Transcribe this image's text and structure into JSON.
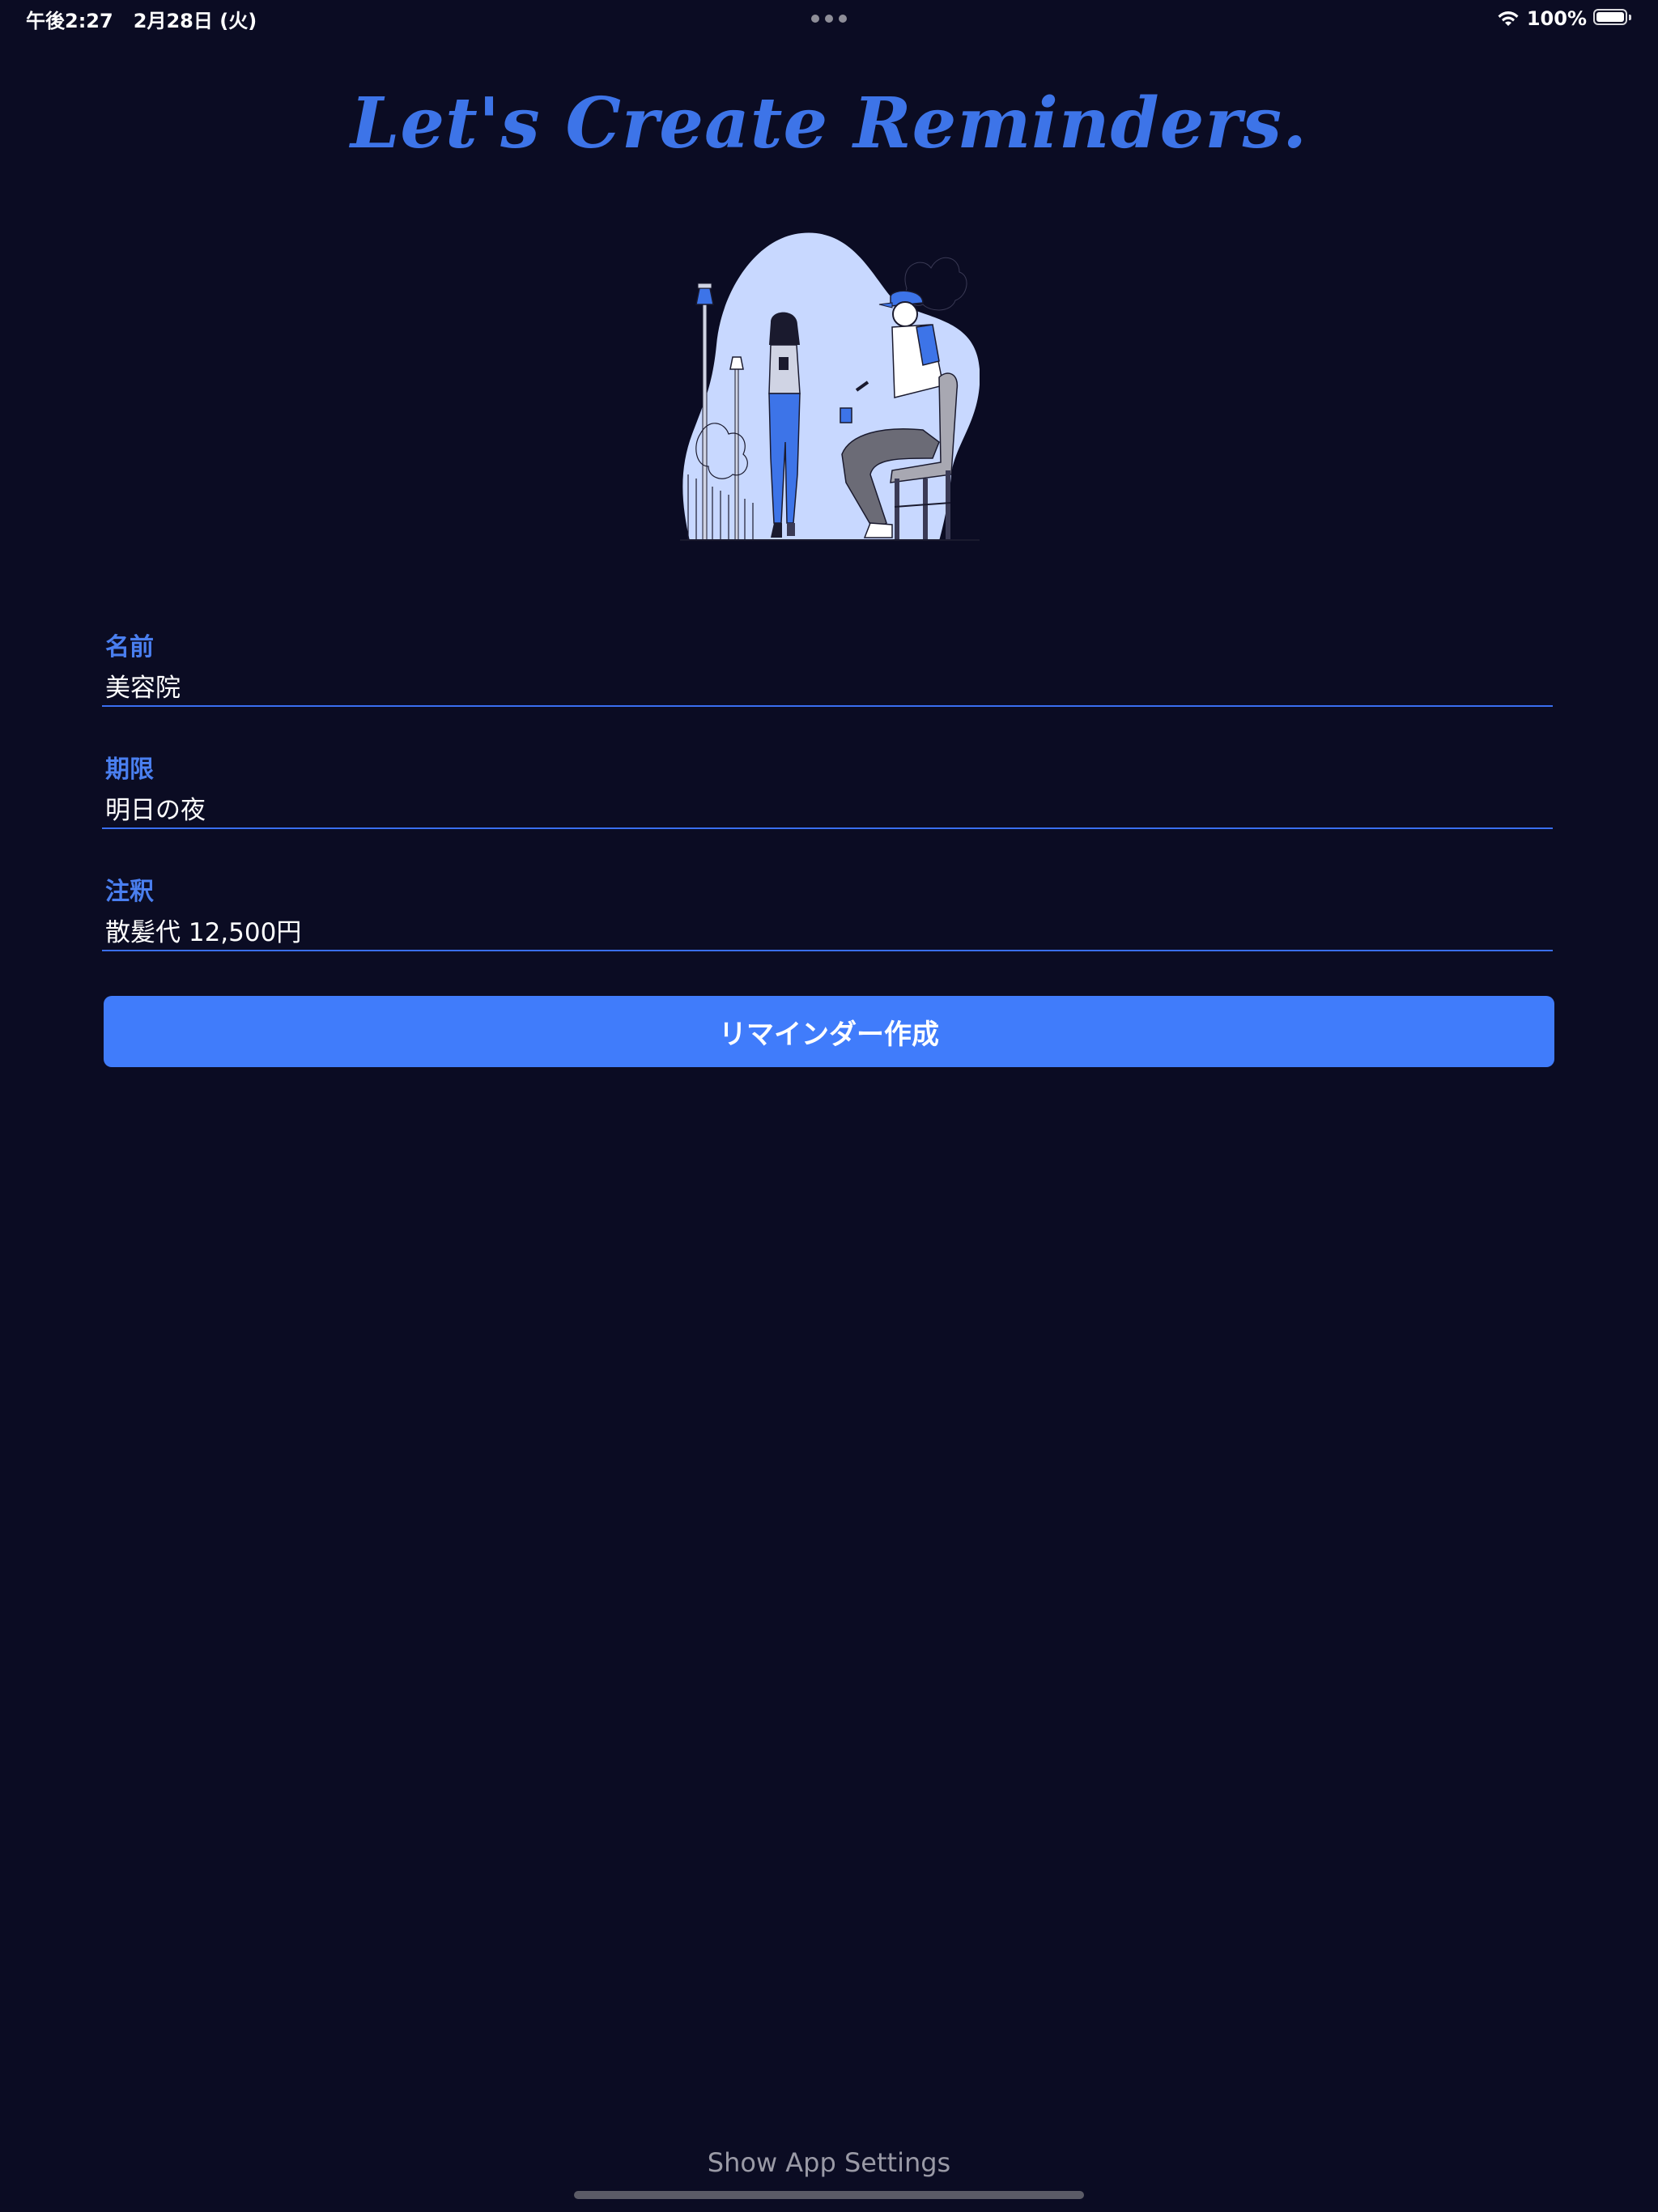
{
  "status_bar": {
    "time": "午後2:27",
    "date": "2月28日 (火)",
    "battery": "100%"
  },
  "title": "Let's Create Reminders.",
  "illustration": {
    "description_icon": "people-with-phones-illustration",
    "colors": {
      "blob": "#c7d7ff",
      "accent": "#3d74e8",
      "line": "#1a1a2e"
    }
  },
  "form": {
    "name": {
      "label": "名前",
      "value": "美容院"
    },
    "due": {
      "label": "期限",
      "value": "明日の夜"
    },
    "note": {
      "label": "注釈",
      "value": "散髪代 12,500円"
    }
  },
  "create_button_label": "リマインダー作成",
  "settings_link": "Show App Settings",
  "colors": {
    "background": "#0b0c23",
    "accent": "#407cfb",
    "label": "#4a7ff0"
  }
}
